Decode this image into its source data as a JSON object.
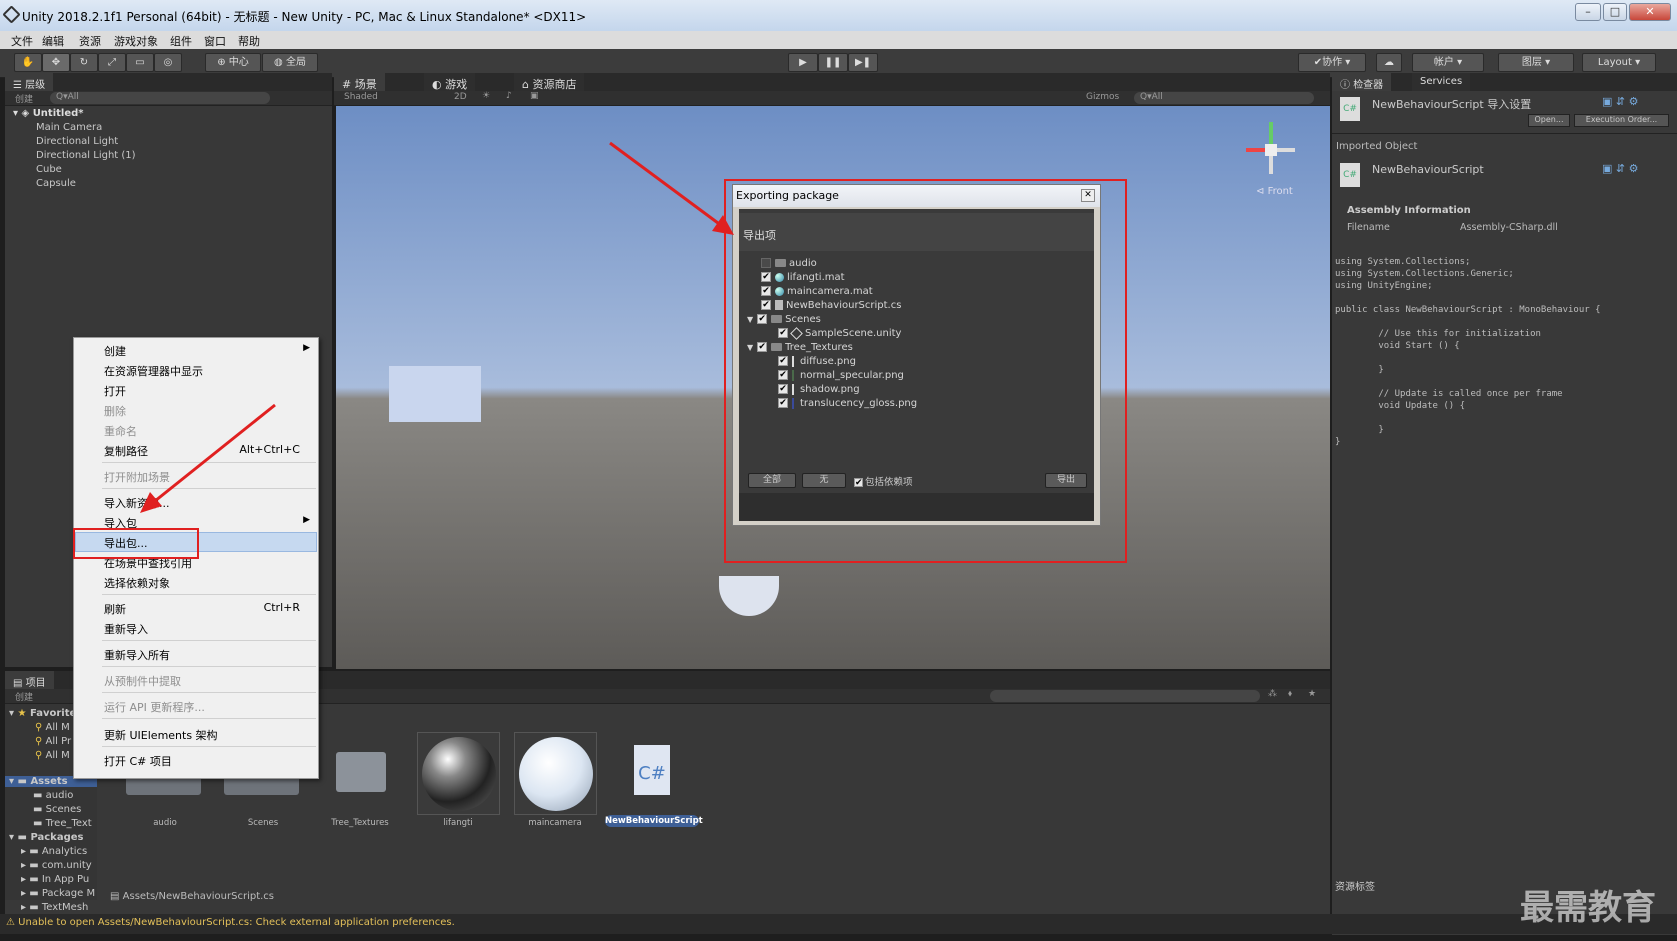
{
  "window": {
    "title": "Unity 2018.2.1f1 Personal (64bit) - 无标题 - New Unity - PC, Mac & Linux Standalone* <DX11>"
  },
  "menu": [
    "文件",
    "编辑",
    "资源",
    "游戏对象",
    "组件",
    "窗口",
    "帮助"
  ],
  "toolbar": {
    "pivot": "中心",
    "space": "全局",
    "collab": "协作",
    "account": "帐户",
    "layers": "图层",
    "layout": "Layout"
  },
  "hierarchy": {
    "tab": "层级",
    "create": "创建",
    "search": "Q▾All",
    "scene": "Untitled*",
    "items": [
      "Main Camera",
      "Directional Light",
      "Directional Light (1)",
      "Cube",
      "Capsule"
    ]
  },
  "scene_tabs": {
    "scene": "场景",
    "game": "游戏",
    "store": "资源商店",
    "shading": "Shaded",
    "mode2d": "2D",
    "gizmos": "Gizmos",
    "search": "Q▾All",
    "orient": "Front"
  },
  "context_menu": {
    "items": [
      {
        "label": "创建",
        "shortcut": "",
        "disabled": false,
        "sub": true
      },
      {
        "label": "在资源管理器中显示",
        "shortcut": "",
        "disabled": false,
        "sub": false
      },
      {
        "label": "打开",
        "shortcut": "",
        "disabled": false,
        "sub": false
      },
      {
        "label": "删除",
        "shortcut": "",
        "disabled": true,
        "sub": false
      },
      {
        "label": "重命名",
        "shortcut": "",
        "disabled": true,
        "sub": false
      },
      {
        "label": "复制路径",
        "shortcut": "Alt+Ctrl+C",
        "disabled": false,
        "sub": false
      },
      {
        "label": "打开附加场景",
        "shortcut": "",
        "disabled": true,
        "sub": false
      },
      {
        "label": "导入新资源...",
        "shortcut": "",
        "disabled": false,
        "sub": false
      },
      {
        "label": "导入包",
        "shortcut": "",
        "disabled": false,
        "sub": true
      },
      {
        "label": "导出包...",
        "shortcut": "",
        "disabled": false,
        "sub": false
      },
      {
        "label": "在场景中查找引用",
        "shortcut": "",
        "disabled": false,
        "sub": false
      },
      {
        "label": "选择依赖对象",
        "shortcut": "",
        "disabled": false,
        "sub": false
      },
      {
        "label": "刷新",
        "shortcut": "Ctrl+R",
        "disabled": false,
        "sub": false
      },
      {
        "label": "重新导入",
        "shortcut": "",
        "disabled": false,
        "sub": false
      },
      {
        "label": "重新导入所有",
        "shortcut": "",
        "disabled": false,
        "sub": false
      },
      {
        "label": "从预制件中提取",
        "shortcut": "",
        "disabled": true,
        "sub": false
      },
      {
        "label": "运行 API 更新程序...",
        "shortcut": "",
        "disabled": true,
        "sub": false
      },
      {
        "label": "更新 UIElements 架构",
        "shortcut": "",
        "disabled": false,
        "sub": false
      },
      {
        "label": "打开 C# 项目",
        "shortcut": "",
        "disabled": false,
        "sub": false
      }
    ]
  },
  "export_dialog": {
    "title": "Exporting package",
    "header": "导出项",
    "items": [
      {
        "label": "audio",
        "checked": false,
        "icon": "folder"
      },
      {
        "label": "lifangti.mat",
        "checked": true,
        "icon": "material"
      },
      {
        "label": "maincamera.mat",
        "checked": true,
        "icon": "material"
      },
      {
        "label": "NewBehaviourScript.cs",
        "checked": true,
        "icon": "script"
      },
      {
        "label": "Scenes",
        "checked": true,
        "icon": "folder"
      },
      {
        "label": "SampleScene.unity",
        "checked": true,
        "icon": "unity"
      },
      {
        "label": "Tree_Textures",
        "checked": true,
        "icon": "folder"
      },
      {
        "label": "diffuse.png",
        "checked": true,
        "icon": "png"
      },
      {
        "label": "normal_specular.png",
        "checked": true,
        "icon": "png"
      },
      {
        "label": "shadow.png",
        "checked": true,
        "icon": "png"
      },
      {
        "label": "translucency_gloss.png",
        "checked": true,
        "icon": "png"
      }
    ],
    "btn_all": "全部",
    "btn_none": "无",
    "include_deps": "包括依赖项",
    "btn_export": "导出"
  },
  "inspector": {
    "tab": "检查器",
    "services": "Services",
    "title": "NewBehaviourScript 导入设置",
    "open": "Open...",
    "exec_order": "Execution Order...",
    "imported_object": "Imported Object",
    "object_name": "NewBehaviourScript",
    "assembly_info": "Assembly Information",
    "filename_label": "Filename",
    "filename_value": "Assembly-CSharp.dll",
    "code": [
      "using System.Collections;",
      "using System.Collections.Generic;",
      "using UnityEngine;",
      "",
      "public class NewBehaviourScript : MonoBehaviour {",
      "",
      "        // Use this for initialization",
      "        void Start () {",
      "",
      "        }",
      "",
      "        // Update is called once per frame",
      "        void Update () {",
      "",
      "        }",
      "}"
    ],
    "asset_labels": "资源标签"
  },
  "project": {
    "tab": "项目",
    "create": "创建",
    "favorites": "Favorites",
    "fav_items": [
      "All M",
      "All Pr",
      "All M"
    ],
    "assets": "Assets",
    "asset_folders": [
      "audio",
      "Scenes",
      "Tree_Text"
    ],
    "packages": "Packages",
    "package_items": [
      "Analytics",
      "com.unity",
      "In App Pu",
      "Package M",
      "TextMesh"
    ],
    "grid": [
      "audio",
      "Scenes",
      "Tree_Textures",
      "lifangti",
      "maincamera",
      "NewBehaviourScript"
    ],
    "path": "Assets/NewBehaviourScript.cs"
  },
  "status": {
    "message": "Unable to open Assets/NewBehaviourScript.cs: Check external application preferences."
  },
  "watermark": "最需教育"
}
